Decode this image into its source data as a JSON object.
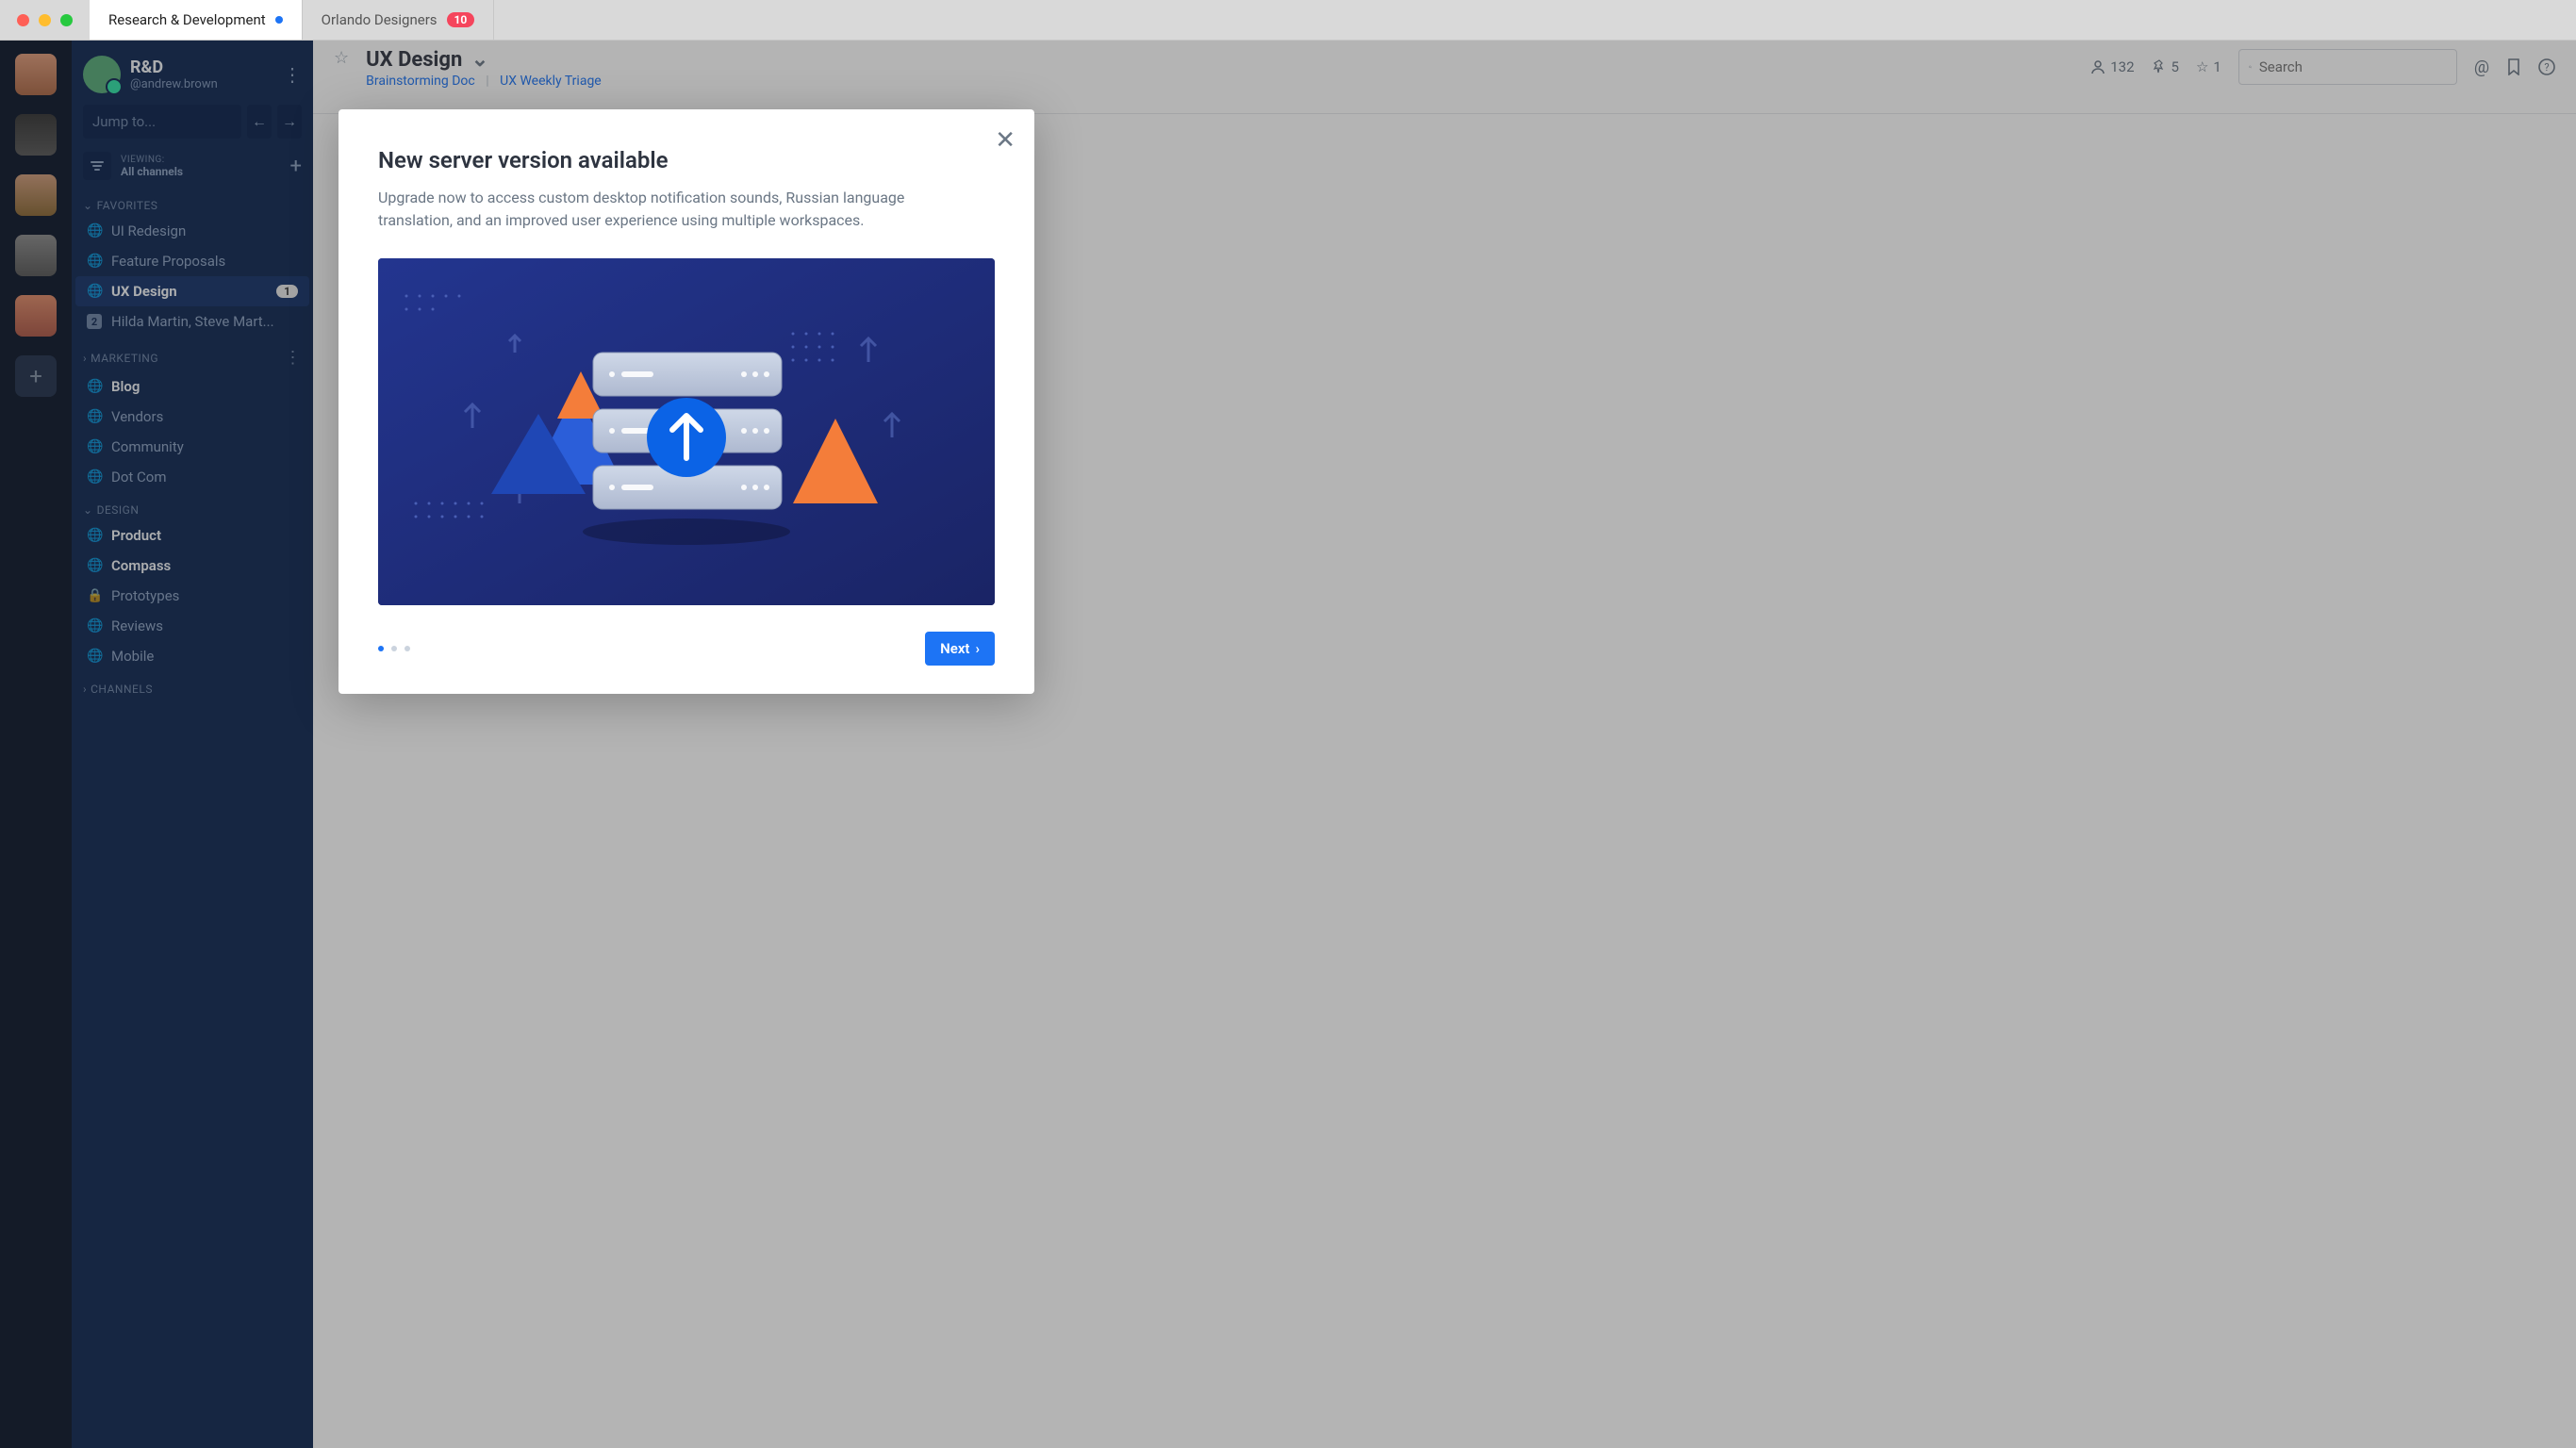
{
  "tabs": [
    {
      "label": "Research & Development",
      "active": true,
      "indicator": "dot"
    },
    {
      "label": "Orlando Designers",
      "active": false,
      "indicator": "10"
    }
  ],
  "workspace": {
    "name": "R&D",
    "user": "@andrew.brown"
  },
  "jump_placeholder": "Jump to...",
  "viewing": {
    "label": "VIEWING:",
    "value": "All channels"
  },
  "sections": [
    {
      "name": "FAVORITES",
      "expanded": true,
      "items": [
        {
          "label": "UI Redesign",
          "icon": "globe"
        },
        {
          "label": "Feature Proposals",
          "icon": "globe"
        },
        {
          "label": "UX Design",
          "icon": "globe",
          "active": true,
          "badge": "1"
        },
        {
          "label": "Hilda Martin, Steve Mart...",
          "icon": "square2"
        }
      ]
    },
    {
      "name": "MARKETING",
      "expanded": true,
      "more": true,
      "items": [
        {
          "label": "Blog",
          "icon": "globe",
          "unread": true
        },
        {
          "label": "Vendors",
          "icon": "globe"
        },
        {
          "label": "Community",
          "icon": "globe"
        },
        {
          "label": "Dot Com",
          "icon": "globe"
        }
      ]
    },
    {
      "name": "DESIGN",
      "expanded": true,
      "items": [
        {
          "label": "Product",
          "icon": "globe",
          "unread": true
        },
        {
          "label": "Compass",
          "icon": "globe",
          "unread": true
        },
        {
          "label": "Prototypes",
          "icon": "lock"
        },
        {
          "label": "Reviews",
          "icon": "globe"
        },
        {
          "label": "Mobile",
          "icon": "globe"
        }
      ]
    },
    {
      "name": "CHANNELS",
      "expanded": false,
      "items": []
    }
  ],
  "channel_header": {
    "name": "UX Design",
    "links": [
      "Brainstorming Doc",
      "UX Weekly Triage"
    ],
    "members": "132",
    "pins": "5",
    "stars": "1",
    "search_placeholder": "Search"
  },
  "modal": {
    "title": "New server version available",
    "body": "Upgrade now to access custom desktop notification sounds, Russian language translation, and an improved user experience using multiple workspaces.",
    "next": "Next",
    "dot_count": 3,
    "dot_active": 0
  }
}
